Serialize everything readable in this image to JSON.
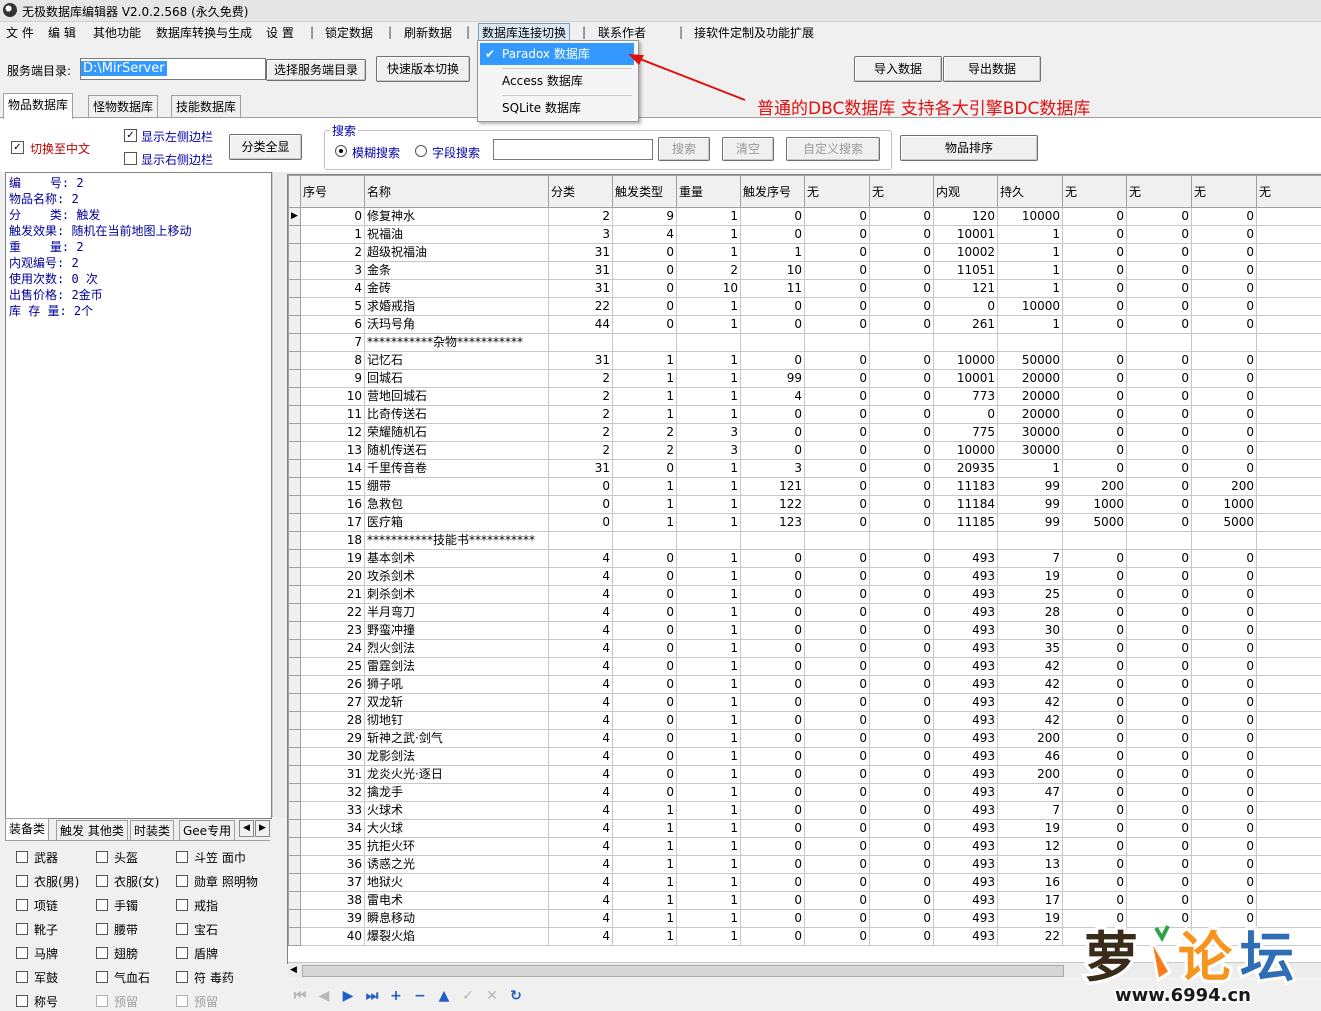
{
  "window": {
    "title": "无极数据库编辑器 V2.0.2.568 (永久免费)"
  },
  "menu": [
    {
      "label": "文 件"
    },
    {
      "label": "编 辑"
    },
    {
      "label": "其他功能"
    },
    {
      "label": "数据库转换与生成"
    },
    {
      "label": "设 置"
    },
    {
      "label": "锁定数据"
    },
    {
      "label": "刷新数据"
    },
    {
      "label": "数据库连接切换"
    },
    {
      "label": "联系作者"
    },
    {
      "label": "接软件定制及功能扩展"
    }
  ],
  "toolbar": {
    "server_dir_label": "服务端目录:",
    "server_dir_value": "D:\\MirServer",
    "select_dir_button": "选择服务端目录",
    "quick_switch_button": "快速版本切换",
    "import_button": "导入数据",
    "export_button": "导出数据"
  },
  "db_dropdown": {
    "items": [
      {
        "label": "Paradox   数据库",
        "checked": true
      },
      {
        "label": "Access 数据库",
        "checked": false
      },
      {
        "label": "SQLite  数据库",
        "checked": false
      }
    ]
  },
  "annotation": {
    "text": "普通的DBC数据库  支持各大引擎BDC数据库",
    "color": "#e01010"
  },
  "tabs": [
    {
      "label": "物品数据库",
      "active": true
    },
    {
      "label": "怪物数据库",
      "active": false
    },
    {
      "label": "技能数据库",
      "active": false
    }
  ],
  "options": {
    "switch_chinese": {
      "label": "切换至中文",
      "checked": true
    },
    "show_left": {
      "label": "显示左侧边栏",
      "checked": true
    },
    "show_right": {
      "label": "显示右侧边栏",
      "checked": false
    },
    "show_all_categories": "分类全显",
    "search_group_title": "搜索",
    "fuzzy_search": {
      "label": "模糊搜索",
      "checked": true
    },
    "field_search": {
      "label": "字段搜索",
      "checked": false
    },
    "search_value": "",
    "search_button": "搜索",
    "clear_button": "清空",
    "custom_search_button": "自定义搜索",
    "sort_button": "物品排序"
  },
  "detail": [
    "编    号: 2",
    "物品名称: 2",
    "分    类: 触发",
    "触发效果: 随机在当前地图上移动",
    "重    量: 2",
    "内观编号: 2",
    "使用次数: 0 次",
    "出售价格: 2金币",
    "库 存 量: 2个"
  ],
  "category_tabs": [
    {
      "label": "装备类",
      "active": true
    },
    {
      "label": "触发 其他类",
      "active": false
    },
    {
      "label": "时装类",
      "active": false
    },
    {
      "label": "Gee专用",
      "active": false
    }
  ],
  "category_checkboxes": [
    [
      {
        "label": "武器"
      },
      {
        "label": "头盔"
      },
      {
        "label": "斗笠 面巾"
      }
    ],
    [
      {
        "label": "衣服(男)"
      },
      {
        "label": "衣服(女)"
      },
      {
        "label": "勋章 照明物"
      }
    ],
    [
      {
        "label": "项链"
      },
      {
        "label": "手镯"
      },
      {
        "label": "戒指"
      }
    ],
    [
      {
        "label": "靴子"
      },
      {
        "label": "腰带"
      },
      {
        "label": "宝石"
      }
    ],
    [
      {
        "label": "马牌"
      },
      {
        "label": "翅膀"
      },
      {
        "label": "盾牌"
      }
    ],
    [
      {
        "label": "军鼓"
      },
      {
        "label": "气血石"
      },
      {
        "label": "符 毒药"
      }
    ],
    [
      {
        "label": "称号"
      },
      {
        "label": "预留",
        "disabled": true
      },
      {
        "label": "预留",
        "disabled": true
      }
    ]
  ],
  "grid": {
    "columns": [
      "序号",
      "名称",
      "分类",
      "触发类型",
      "重量",
      "触发序号",
      "无",
      "无",
      "内观",
      "持久",
      "无",
      "无",
      "无",
      "无"
    ],
    "rows": [
      [
        "0",
        "修复神水",
        "2",
        "9",
        "1",
        "0",
        "0",
        "0",
        "120",
        "10000",
        "0",
        "0",
        "0",
        ""
      ],
      [
        "1",
        "祝福油",
        "3",
        "4",
        "1",
        "0",
        "0",
        "0",
        "10001",
        "1",
        "0",
        "0",
        "0",
        ""
      ],
      [
        "2",
        "超级祝福油",
        "31",
        "0",
        "1",
        "1",
        "0",
        "0",
        "10002",
        "1",
        "0",
        "0",
        "0",
        ""
      ],
      [
        "3",
        "金条",
        "31",
        "0",
        "2",
        "10",
        "0",
        "0",
        "11051",
        "1",
        "0",
        "0",
        "0",
        ""
      ],
      [
        "4",
        "金砖",
        "31",
        "0",
        "10",
        "11",
        "0",
        "0",
        "121",
        "1",
        "0",
        "0",
        "0",
        ""
      ],
      [
        "5",
        "求婚戒指",
        "22",
        "0",
        "1",
        "0",
        "0",
        "0",
        "0",
        "10000",
        "0",
        "0",
        "0",
        ""
      ],
      [
        "6",
        "沃玛号角",
        "44",
        "0",
        "1",
        "0",
        "0",
        "0",
        "261",
        "1",
        "0",
        "0",
        "0",
        ""
      ],
      [
        "7",
        "***********杂物***********",
        "",
        "",
        "",
        "",
        "",
        "",
        "",
        "",
        "",
        "",
        "",
        ""
      ],
      [
        "8",
        "记忆石",
        "31",
        "1",
        "1",
        "0",
        "0",
        "0",
        "10000",
        "50000",
        "0",
        "0",
        "0",
        ""
      ],
      [
        "9",
        "回城石",
        "2",
        "1",
        "1",
        "99",
        "0",
        "0",
        "10001",
        "20000",
        "0",
        "0",
        "0",
        ""
      ],
      [
        "10",
        "营地回城石",
        "2",
        "1",
        "1",
        "4",
        "0",
        "0",
        "773",
        "20000",
        "0",
        "0",
        "0",
        ""
      ],
      [
        "11",
        "比奇传送石",
        "2",
        "1",
        "1",
        "0",
        "0",
        "0",
        "0",
        "20000",
        "0",
        "0",
        "0",
        ""
      ],
      [
        "12",
        "荣耀随机石",
        "2",
        "2",
        "3",
        "0",
        "0",
        "0",
        "775",
        "30000",
        "0",
        "0",
        "0",
        ""
      ],
      [
        "13",
        "随机传送石",
        "2",
        "2",
        "3",
        "0",
        "0",
        "0",
        "10000",
        "30000",
        "0",
        "0",
        "0",
        ""
      ],
      [
        "14",
        "千里传音卷",
        "31",
        "0",
        "1",
        "3",
        "0",
        "0",
        "20935",
        "1",
        "0",
        "0",
        "0",
        ""
      ],
      [
        "15",
        "绷带",
        "0",
        "1",
        "1",
        "121",
        "0",
        "0",
        "11183",
        "99",
        "200",
        "0",
        "200",
        ""
      ],
      [
        "16",
        "急救包",
        "0",
        "1",
        "1",
        "122",
        "0",
        "0",
        "11184",
        "99",
        "1000",
        "0",
        "1000",
        ""
      ],
      [
        "17",
        "医疗箱",
        "0",
        "1",
        "1",
        "123",
        "0",
        "0",
        "11185",
        "99",
        "5000",
        "0",
        "5000",
        ""
      ],
      [
        "18",
        "***********技能书***********",
        "",
        "",
        "",
        "",
        "",
        "",
        "",
        "",
        "",
        "",
        "",
        ""
      ],
      [
        "19",
        "基本剑术",
        "4",
        "0",
        "1",
        "0",
        "0",
        "0",
        "493",
        "7",
        "0",
        "0",
        "0",
        ""
      ],
      [
        "20",
        "攻杀剑术",
        "4",
        "0",
        "1",
        "0",
        "0",
        "0",
        "493",
        "19",
        "0",
        "0",
        "0",
        ""
      ],
      [
        "21",
        "刺杀剑术",
        "4",
        "0",
        "1",
        "0",
        "0",
        "0",
        "493",
        "25",
        "0",
        "0",
        "0",
        ""
      ],
      [
        "22",
        "半月弯刀",
        "4",
        "0",
        "1",
        "0",
        "0",
        "0",
        "493",
        "28",
        "0",
        "0",
        "0",
        ""
      ],
      [
        "23",
        "野蛮冲撞",
        "4",
        "0",
        "1",
        "0",
        "0",
        "0",
        "493",
        "30",
        "0",
        "0",
        "0",
        ""
      ],
      [
        "24",
        "烈火剑法",
        "4",
        "0",
        "1",
        "0",
        "0",
        "0",
        "493",
        "35",
        "0",
        "0",
        "0",
        ""
      ],
      [
        "25",
        "雷霆剑法",
        "4",
        "0",
        "1",
        "0",
        "0",
        "0",
        "493",
        "42",
        "0",
        "0",
        "0",
        ""
      ],
      [
        "26",
        "狮子吼",
        "4",
        "0",
        "1",
        "0",
        "0",
        "0",
        "493",
        "42",
        "0",
        "0",
        "0",
        ""
      ],
      [
        "27",
        "双龙斩",
        "4",
        "0",
        "1",
        "0",
        "0",
        "0",
        "493",
        "42",
        "0",
        "0",
        "0",
        ""
      ],
      [
        "28",
        "彻地钉",
        "4",
        "0",
        "1",
        "0",
        "0",
        "0",
        "493",
        "42",
        "0",
        "0",
        "0",
        ""
      ],
      [
        "29",
        "斩神之武·剑气",
        "4",
        "0",
        "1",
        "0",
        "0",
        "0",
        "493",
        "200",
        "0",
        "0",
        "0",
        ""
      ],
      [
        "30",
        "龙影剑法",
        "4",
        "0",
        "1",
        "0",
        "0",
        "0",
        "493",
        "46",
        "0",
        "0",
        "0",
        ""
      ],
      [
        "31",
        "龙炎火光·逐日",
        "4",
        "0",
        "1",
        "0",
        "0",
        "0",
        "493",
        "200",
        "0",
        "0",
        "0",
        ""
      ],
      [
        "32",
        "擒龙手",
        "4",
        "0",
        "1",
        "0",
        "0",
        "0",
        "493",
        "47",
        "0",
        "0",
        "0",
        ""
      ],
      [
        "33",
        "火球术",
        "4",
        "1",
        "1",
        "0",
        "0",
        "0",
        "493",
        "7",
        "0",
        "0",
        "0",
        ""
      ],
      [
        "34",
        "大火球",
        "4",
        "1",
        "1",
        "0",
        "0",
        "0",
        "493",
        "19",
        "0",
        "0",
        "0",
        ""
      ],
      [
        "35",
        "抗拒火环",
        "4",
        "1",
        "1",
        "0",
        "0",
        "0",
        "493",
        "12",
        "0",
        "0",
        "0",
        ""
      ],
      [
        "36",
        "诱惑之光",
        "4",
        "1",
        "1",
        "0",
        "0",
        "0",
        "493",
        "13",
        "0",
        "0",
        "0",
        ""
      ],
      [
        "37",
        "地狱火",
        "4",
        "1",
        "1",
        "0",
        "0",
        "0",
        "493",
        "16",
        "0",
        "0",
        "0",
        ""
      ],
      [
        "38",
        "雷电术",
        "4",
        "1",
        "1",
        "0",
        "0",
        "0",
        "493",
        "17",
        "0",
        "0",
        "0",
        ""
      ],
      [
        "39",
        "瞬息移动",
        "4",
        "1",
        "1",
        "0",
        "0",
        "0",
        "493",
        "19",
        "0",
        "0",
        "0",
        ""
      ],
      [
        "40",
        "爆裂火焰",
        "4",
        "1",
        "1",
        "0",
        "0",
        "0",
        "493",
        "22",
        "0",
        "0",
        "0",
        ""
      ]
    ]
  },
  "navigator_icons": [
    "first-icon",
    "prior-icon",
    "next-icon",
    "last-icon",
    "insert-icon",
    "delete-icon",
    "edit-icon",
    "post-icon",
    "cancel-icon",
    "refresh-icon"
  ],
  "watermark": {
    "logo_text": "萝卜论坛",
    "url_text": "www.6994.cn"
  }
}
